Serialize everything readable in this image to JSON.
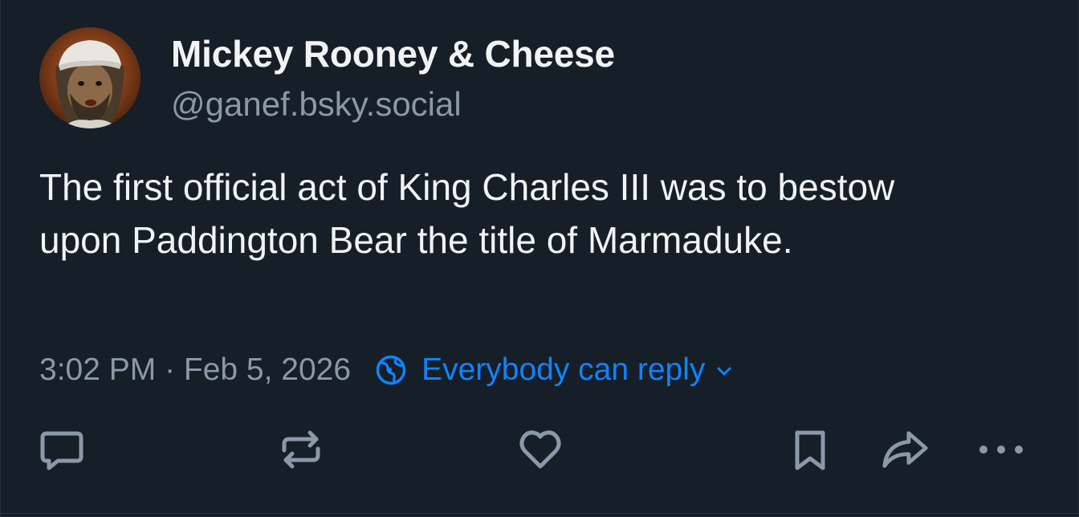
{
  "author": {
    "display_name": "Mickey Rooney & Cheese",
    "handle": "@ganef.bsky.social"
  },
  "post": {
    "text": "The first official act of King Charles III was to bestow upon Paddington Bear the title of Marmaduke.",
    "timestamp": "3:02 PM · Feb 5, 2026"
  },
  "reply_setting": {
    "label": "Everybody can reply",
    "icon": "globe-icon"
  },
  "actions": [
    {
      "name": "reply",
      "icon": "speech-bubble-icon"
    },
    {
      "name": "repost",
      "icon": "repost-icon"
    },
    {
      "name": "like",
      "icon": "heart-icon"
    },
    {
      "name": "bookmark",
      "icon": "bookmark-icon"
    },
    {
      "name": "share",
      "icon": "share-arrow-icon"
    },
    {
      "name": "more",
      "icon": "ellipsis-icon"
    }
  ],
  "colors": {
    "background": "#161e27",
    "text_primary": "#f1f3f5",
    "text_secondary": "#8b98a8",
    "accent": "#1083fe",
    "icon": "#8b98a8"
  }
}
